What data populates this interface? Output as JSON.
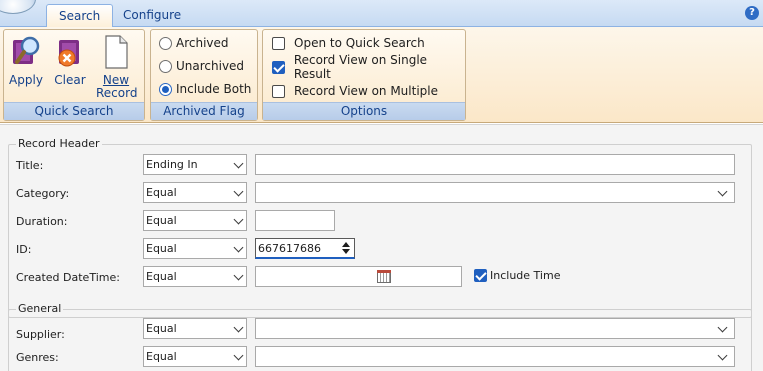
{
  "tabs": [
    {
      "label": "Search",
      "active": true
    },
    {
      "label": "Configure",
      "active": false
    }
  ],
  "help_icon": "?",
  "ribbon": {
    "quick_search": {
      "caption": "Quick Search",
      "buttons": [
        {
          "label": "Apply",
          "icon": "magnifier-apply-icon"
        },
        {
          "label": "Clear",
          "icon": "clear-eraser-icon"
        },
        {
          "label_line1": "New",
          "label_line2": "Record",
          "icon": "new-document-icon"
        }
      ]
    },
    "archived_flag": {
      "caption": "Archived Flag",
      "options": [
        "Archived",
        "Unarchived",
        "Include Both"
      ],
      "selected": "Include Both"
    },
    "options": {
      "caption": "Options",
      "items": [
        {
          "label": "Open to Quick Search",
          "checked": false
        },
        {
          "label": "Record View on Single Result",
          "checked": true
        },
        {
          "label": "Record View on Multiple",
          "checked": false
        }
      ]
    }
  },
  "record_header": {
    "legend": "Record Header",
    "fields": [
      {
        "label": "Title:",
        "operator": "Ending In",
        "value": ""
      },
      {
        "label": "Category:",
        "operator": "Equal",
        "value": ""
      },
      {
        "label": "Duration:",
        "operator": "Equal",
        "value": ""
      },
      {
        "label": "ID:",
        "operator": "Equal",
        "value": "667617686"
      },
      {
        "label": "Created DateTime:",
        "operator": "Equal",
        "value": ""
      }
    ],
    "include_time": {
      "label": "Include Time",
      "checked": true
    }
  },
  "general": {
    "legend": "General",
    "fields": [
      {
        "label": "Supplier:",
        "operator": "Equal",
        "value": ""
      },
      {
        "label": "Genres:",
        "operator": "Equal",
        "value": ""
      }
    ]
  },
  "colors": {
    "accent_blue": "#1f5fbf",
    "ribbon_caption_text": "#15428b",
    "ribbon_bg": "#fbe7c8"
  }
}
